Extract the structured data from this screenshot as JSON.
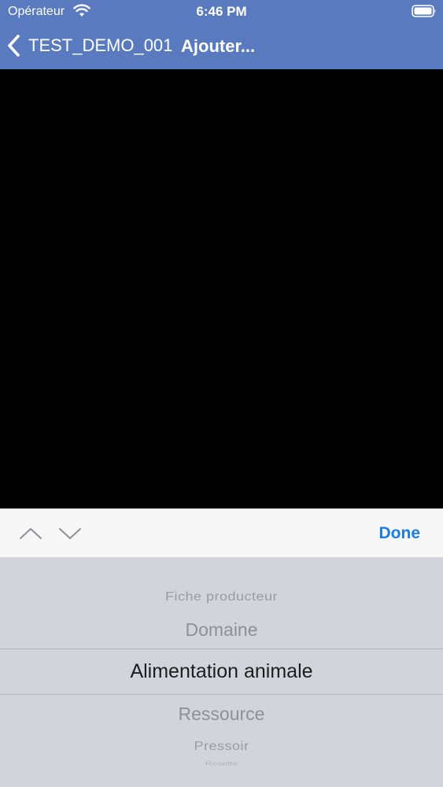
{
  "status_bar": {
    "carrier": "Opérateur",
    "time": "6:46 PM",
    "icons": [
      "wifi-icon",
      "battery-icon"
    ]
  },
  "nav_bar": {
    "back_label": "TEST_DEMO_001",
    "title": "Ajouter...",
    "back_icon": "chevron-left-icon"
  },
  "colors": {
    "nav_background": "#5a7abf",
    "content_background": "#000000",
    "toolbar_background": "#f7f7f8",
    "picker_background": "#d1d4da",
    "accent": "#1b7ee0"
  },
  "accessory_toolbar": {
    "prev_icon": "chevron-up-icon",
    "next_icon": "chevron-down-icon",
    "done_label": "Done"
  },
  "picker": {
    "options": [
      "Fiche producteur",
      "Domaine",
      "Alimentation animale",
      "Ressource",
      "Pressoir",
      "Rosette"
    ],
    "selected": "Alimentation animale"
  }
}
